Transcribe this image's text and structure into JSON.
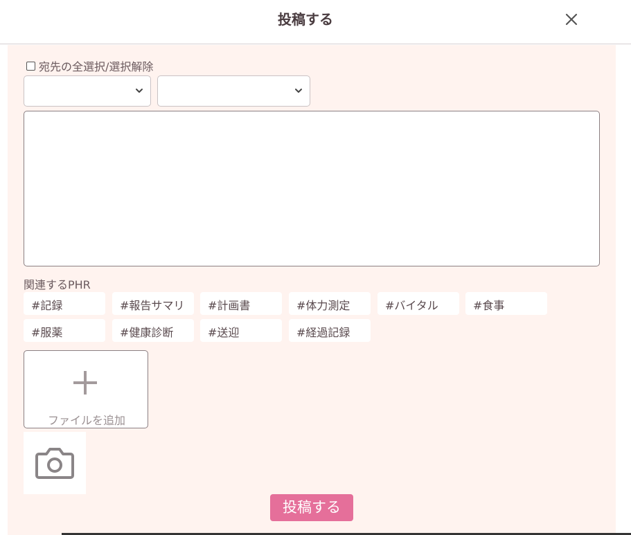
{
  "header": {
    "title": "投稿する",
    "close_icon": "close-icon"
  },
  "recipients": {
    "select_all_label": "宛先の全選択/選択解除",
    "select_all_checked": false,
    "dropdown_1_value": "",
    "dropdown_2_value": ""
  },
  "message": {
    "value": ""
  },
  "phr": {
    "label": "関連するPHR",
    "tags": [
      "#記録",
      "#報告サマリ",
      "#計画書",
      "#体力測定",
      "#バイタル",
      "#食事",
      "#服薬",
      "#健康診断",
      "#送迎",
      "#経過記録"
    ]
  },
  "attachments": {
    "add_file_label": "ファイルを追加",
    "add_file_icon": "plus-icon",
    "camera_icon": "camera-icon"
  },
  "actions": {
    "submit_label": "投稿する"
  },
  "colors": {
    "body_bg": "#fff3ef",
    "accent": "#e56f9a"
  }
}
